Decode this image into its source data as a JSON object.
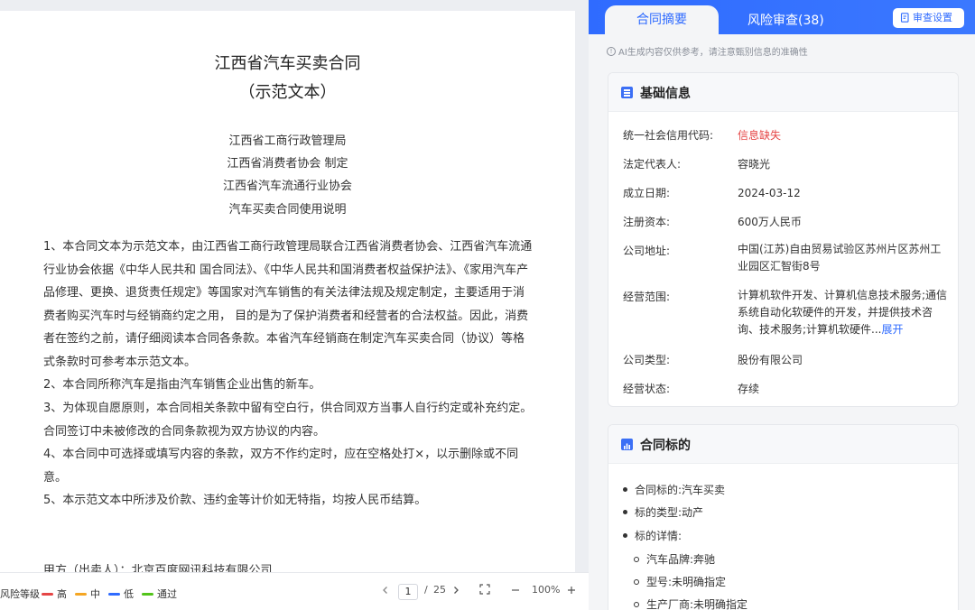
{
  "document": {
    "title": "江西省汽车买卖合同",
    "subtitle": "（示范文本）",
    "issuers": [
      "江西省工商行政管理局",
      "江西省消费者协会 制定",
      "江西省汽车流通行业协会",
      "汽车买卖合同使用说明"
    ],
    "paragraphs": [
      "1、本合同文本为示范文本，由江西省工商行政管理局联合江西省消费者协会、江西省汽车流通行业协会依据《中华人民共和 国合同法》、《中华人民共和国消费者权益保护法》、《家用汽车产 品修理、更换、退货责任规定》等国家对汽车销售的有关法律法规及规定制定，主要适用于消费者购买汽车时与经销商约定之用， 目的是为了保护消费者和经营者的合法权益。因此，消费者在签约之前，请仔细阅读本合同各条款。本省汽车经销商在制定汽车买卖合同（协议）等格式条款时可参考本示范文本。",
      "2、本合同所称汽车是指由汽车销售企业出售的新车。",
      "3、为体现自愿原则，本合同相关条款中留有空白行，供合同双方当事人自行约定或补充约定。合同签订中未被修改的合同条款视为双方协议的内容。",
      "4、本合同中可选择或填写内容的条款，双方不作约定时，应在空格处打×，以示删除或不同意。",
      "5、本示范文本中所涉及价款、违约金等计价如无特指，均按人民币结算。"
    ],
    "party_line": "甲方（出卖人）：北京百度网讯科技有限公司"
  },
  "toolbar": {
    "risk_legend_label": "风险等级",
    "legend": [
      {
        "label": "高",
        "color": "#e54545"
      },
      {
        "label": "中",
        "color": "#f5a623"
      },
      {
        "label": "低",
        "color": "#2f6bff"
      },
      {
        "label": "通过",
        "color": "#52c41a"
      }
    ],
    "current_page": "1",
    "page_separator": "/",
    "total_pages": "25",
    "zoom": "100%",
    "prev_icon": "chevron-left-icon",
    "next_icon": "chevron-right-icon"
  },
  "panel": {
    "tabs": {
      "summary": "合同摘要",
      "risk": "风险审查(38)"
    },
    "review_settings": "审查设置",
    "ai_notice": "AI生成内容仅供参考，请注意甄别信息的准确性",
    "basic_info": {
      "title": "基础信息",
      "rows": [
        {
          "label": "统一社会信用代码:",
          "value": "信息缺失"
        },
        {
          "label": "法定代表人:",
          "value": "容晓光"
        },
        {
          "label": "成立日期:",
          "value": "2024-03-12"
        },
        {
          "label": "注册资本:",
          "value": "600万人民币"
        },
        {
          "label": "公司地址:",
          "value": "中国(江苏)自由贸易试验区苏州片区苏州工业园区汇智街8号"
        },
        {
          "label": "经营范围:",
          "value": "计算机软件开发、计算机信息技术服务;通信系统自动化软硬件的开发，并提供技术咨询、技术服务;计算机软硬件...",
          "link": "展开"
        },
        {
          "label": "公司类型:",
          "value": "股份有限公司"
        },
        {
          "label": "经营状态:",
          "value": "存续"
        }
      ]
    },
    "subject": {
      "title": "合同标的",
      "items": [
        {
          "label": "合同标的:",
          "value": "汽车买卖"
        },
        {
          "label": "标的类型:",
          "value": "动产"
        },
        {
          "label": "标的详情:",
          "value": ""
        }
      ],
      "sub_items": [
        {
          "label": "汽车品牌:",
          "value": "奔驰"
        },
        {
          "label": "型号:",
          "value": "未明确指定"
        },
        {
          "label": "生产厂商:",
          "value": "未明确指定"
        }
      ]
    }
  }
}
